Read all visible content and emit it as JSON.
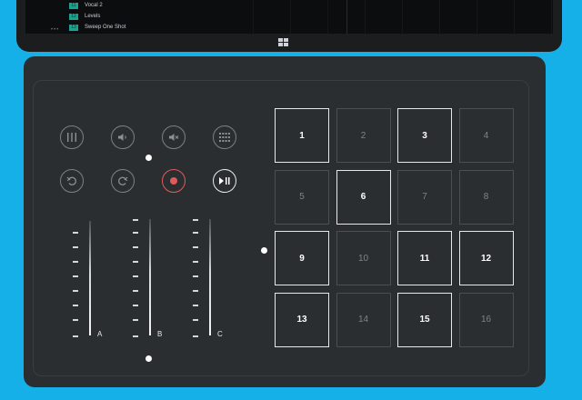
{
  "tablet": {
    "tracks": [
      {
        "tag": "11",
        "name": "Vocal 2"
      },
      {
        "tag": "12",
        "name": "Levels"
      },
      {
        "tag": "13",
        "name": "Sweep One Shot"
      }
    ],
    "more_indicator": "•••"
  },
  "controls": {
    "row1": [
      {
        "icon": "mixer-icon"
      },
      {
        "icon": "volume-icon"
      },
      {
        "icon": "mute-icon"
      },
      {
        "icon": "keypad-grid-icon"
      }
    ],
    "row2": [
      {
        "icon": "undo-icon"
      },
      {
        "icon": "redo-icon"
      },
      {
        "icon": "record-icon"
      },
      {
        "icon": "play-pause-icon"
      }
    ],
    "record_color": "#e05a5a"
  },
  "faders": [
    {
      "label": "A"
    },
    {
      "label": "B"
    },
    {
      "label": "C"
    }
  ],
  "pads": [
    {
      "label": "1",
      "active": true
    },
    {
      "label": "2",
      "active": false
    },
    {
      "label": "3",
      "active": true
    },
    {
      "label": "4",
      "active": false
    },
    {
      "label": "5",
      "active": false
    },
    {
      "label": "6",
      "active": true
    },
    {
      "label": "7",
      "active": false
    },
    {
      "label": "8",
      "active": false
    },
    {
      "label": "9",
      "active": true
    },
    {
      "label": "10",
      "active": false
    },
    {
      "label": "11",
      "active": true
    },
    {
      "label": "12",
      "active": true
    },
    {
      "label": "13",
      "active": true
    },
    {
      "label": "14",
      "active": false
    },
    {
      "label": "15",
      "active": true
    },
    {
      "label": "16",
      "active": false
    }
  ],
  "colors": {
    "background": "#15b0e8",
    "cover": "#2b2e31",
    "accent_track": "#17a38f"
  }
}
